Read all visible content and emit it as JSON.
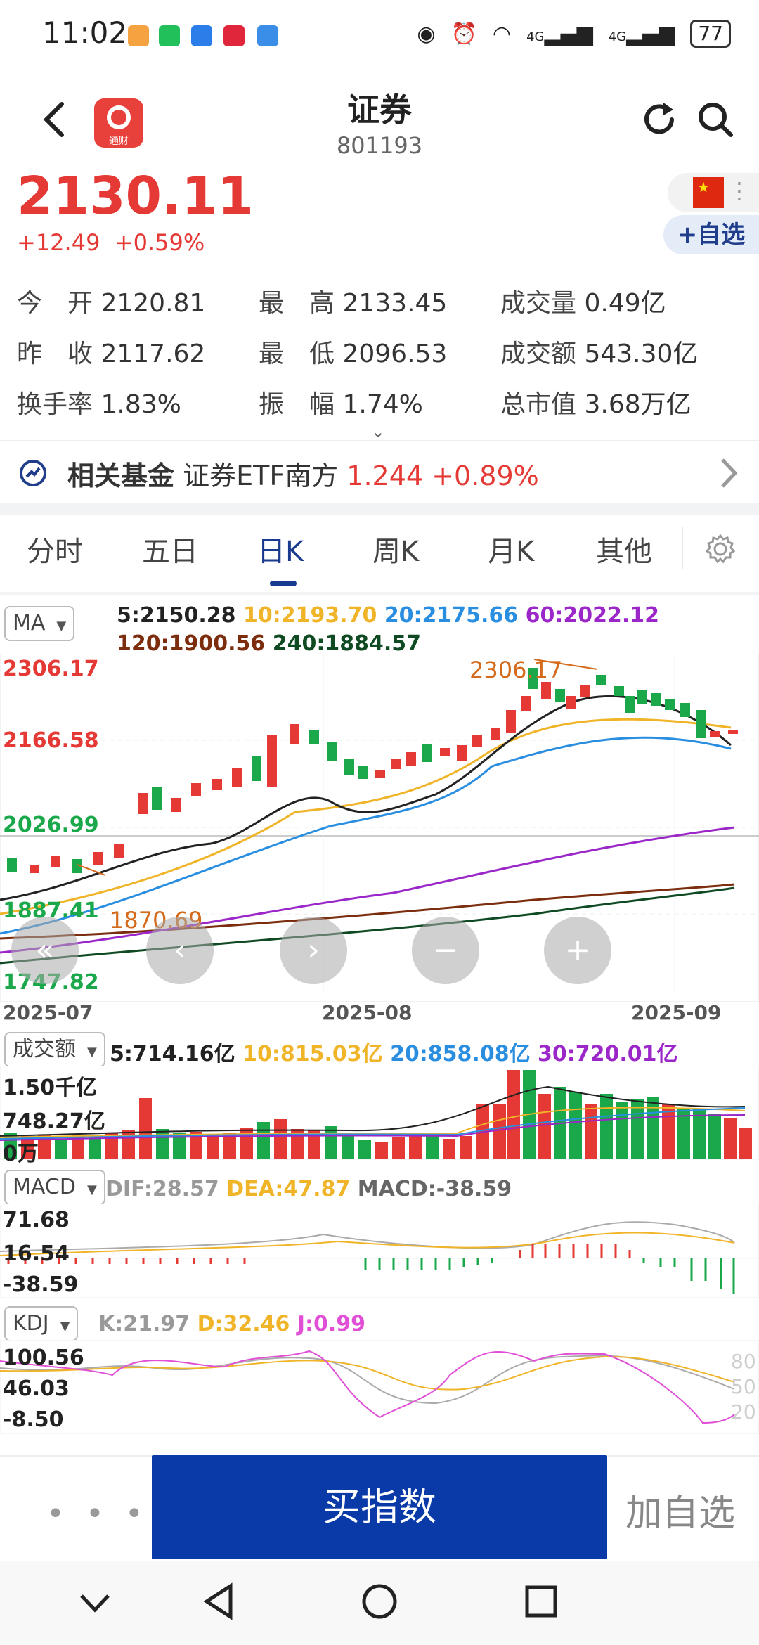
{
  "status_bar": {
    "time": "11:02",
    "battery": "77",
    "network_1": "4G",
    "network_2": "4G"
  },
  "header": {
    "title": "证券",
    "code": "801193",
    "app_logo_text": "通财"
  },
  "quote": {
    "price": "2130.11",
    "change": "+12.49",
    "change_pct": "+0.59%",
    "add_watch": "+自选"
  },
  "stats": [
    {
      "label": "今　开",
      "value": "2120.81"
    },
    {
      "label": "最　高",
      "value": "2133.45"
    },
    {
      "label": "成交量",
      "value": "0.49亿"
    },
    {
      "label": "昨　收",
      "value": "2117.62"
    },
    {
      "label": "最　低",
      "value": "2096.53"
    },
    {
      "label": "成交额",
      "value": "543.30亿"
    },
    {
      "label": "换手率",
      "value": "1.83%"
    },
    {
      "label": "振　幅",
      "value": "1.74%"
    },
    {
      "label": "总市值",
      "value": "3.68万亿"
    }
  ],
  "fund": {
    "title": "相关基金",
    "name": "证券ETF南方",
    "price": "1.244",
    "change_pct": "+0.89%"
  },
  "tabs": [
    {
      "label": "分时"
    },
    {
      "label": "五日"
    },
    {
      "label": "日K"
    },
    {
      "label": "周K"
    },
    {
      "label": "月K"
    },
    {
      "label": "其他"
    }
  ],
  "ma_panel": {
    "selector": "MA",
    "ma5": "5:2150.28",
    "ma10": "10:2193.70",
    "ma20": "20:2175.66",
    "ma60": "60:2022.12",
    "ma120": "120:1900.56",
    "ma240": "240:1884.57",
    "y_labels": [
      "2306.17",
      "2166.58",
      "2026.99",
      "1887.41",
      "1747.82"
    ],
    "high_annot": "2306.17",
    "low_annot": "1870.69",
    "dates": [
      "2025-07",
      "2025-08",
      "2025-09"
    ]
  },
  "volume_panel": {
    "selector": "成交额",
    "ma5": "5:714.16亿",
    "ma10": "10:815.03亿",
    "ma20": "20:858.08亿",
    "ma30": "30:720.01亿",
    "y_labels": [
      "1.50千亿",
      "748.27亿",
      "0万"
    ]
  },
  "macd_panel": {
    "selector": "MACD",
    "dif": "DIF:28.57",
    "dea": "DEA:47.87",
    "macd": "MACD:-38.59",
    "y_labels": [
      "71.68",
      "16.54",
      "-38.59"
    ]
  },
  "kdj_panel": {
    "selector": "KDJ",
    "k": "K:21.97",
    "d": "D:32.46",
    "j": "J:0.99",
    "y_labels": [
      "100.56",
      "46.03",
      "-8.50"
    ],
    "right_labels": [
      "80",
      "50",
      "20"
    ]
  },
  "bottom": {
    "more": "• • •",
    "buy": "买指数",
    "add": "加自选"
  },
  "colors": {
    "up": "#e53935",
    "down": "#1aa84b",
    "ma5": "#222222",
    "ma10": "#f0b429",
    "ma20": "#2a8ee0",
    "ma60": "#9b27c9",
    "ma120": "#7b2d0e",
    "ma240": "#0f4a22",
    "accent": "#0a3aa8"
  }
}
